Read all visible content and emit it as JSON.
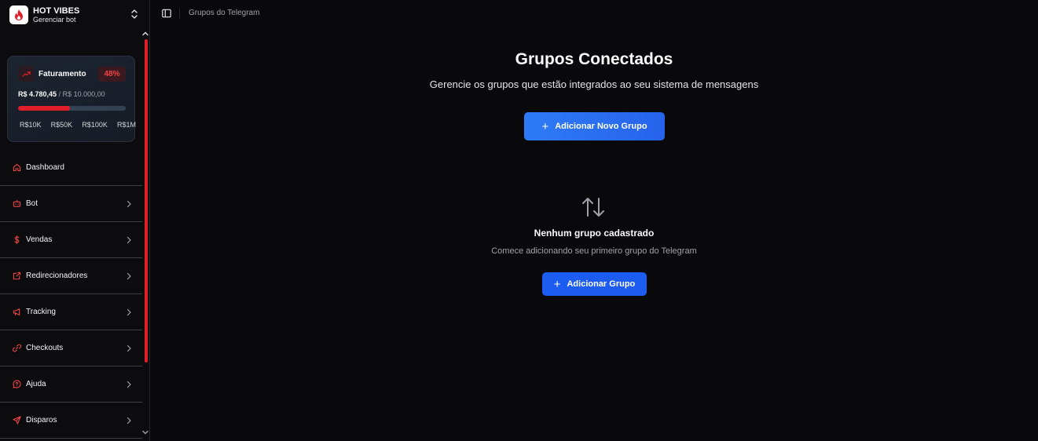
{
  "brand": {
    "name": "HOT VIBES",
    "subtitle": "Gerenciar bot"
  },
  "revenue": {
    "title": "Faturamento",
    "percent_label": "48%",
    "progress_fraction": 0.48,
    "current": "R$ 4.780,45",
    "goal": "/ R$ 10.000,00",
    "milestones": [
      "R$10K",
      "R$50K",
      "R$100K",
      "R$1M"
    ]
  },
  "sidebar": {
    "items": [
      {
        "label": "Dashboard",
        "icon": "home-icon",
        "has_chevron": false
      },
      {
        "label": "Bot",
        "icon": "bot-icon",
        "has_chevron": true
      },
      {
        "label": "Vendas",
        "icon": "dollar-icon",
        "has_chevron": true
      },
      {
        "label": "Redirecionadores",
        "icon": "external-link-icon",
        "has_chevron": true
      },
      {
        "label": "Tracking",
        "icon": "megaphone-icon",
        "has_chevron": true
      },
      {
        "label": "Checkouts",
        "icon": "link-icon",
        "has_chevron": true
      },
      {
        "label": "Ajuda",
        "icon": "help-chat-icon",
        "has_chevron": true
      },
      {
        "label": "Disparos",
        "icon": "send-icon",
        "has_chevron": true
      }
    ]
  },
  "topbar": {
    "breadcrumb": "Grupos do Telegram"
  },
  "main": {
    "title": "Grupos Conectados",
    "subtitle": "Gerencie os grupos que estão integrados ao seu sistema de mensagens",
    "add_new_label": "Adicionar Novo Grupo",
    "empty_title": "Nenhum grupo cadastrado",
    "empty_subtitle": "Comece adicionando seu primeiro grupo do Telegram",
    "add_label": "Adicionar Grupo"
  },
  "colors": {
    "accent_red": "#e11d2a",
    "primary_blue": "#2563eb",
    "background": "#09090b"
  }
}
